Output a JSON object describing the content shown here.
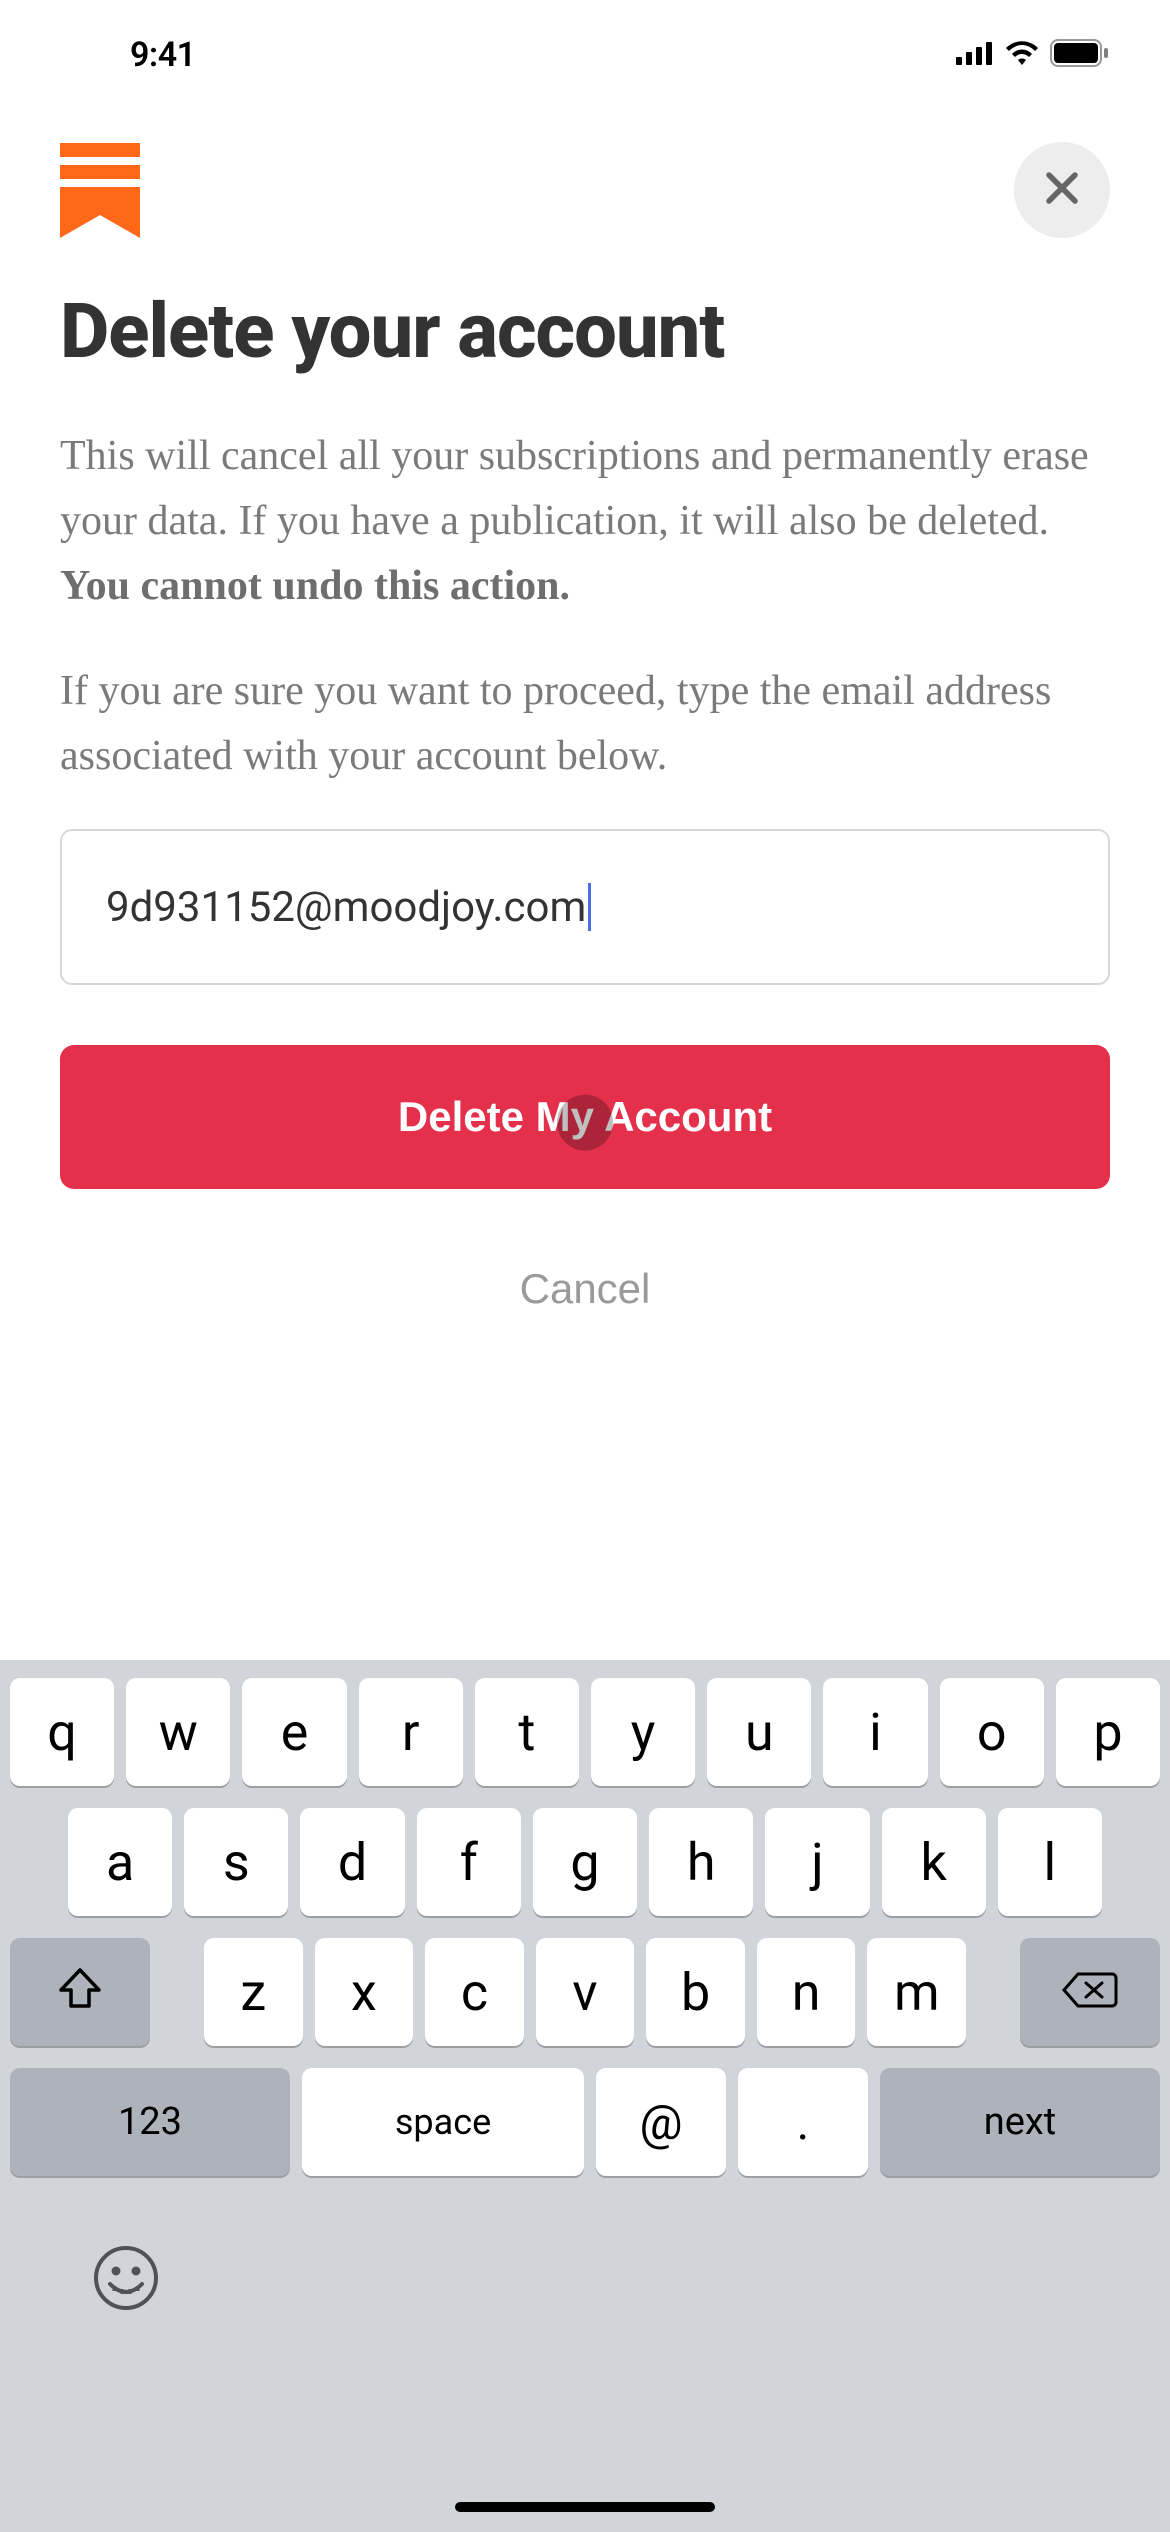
{
  "status": {
    "time": "9:41"
  },
  "nav": {
    "logo_color": "#ff6719"
  },
  "page": {
    "title": "Delete your account",
    "p1a": "This will cancel all your subscriptions and permanently erase your data. If you have a publication, it will also be deleted. ",
    "p1b": "You cannot undo this action.",
    "p2": "If you are sure you want to proceed, type the email address associated with your account below.",
    "email_value": "9d931152@moodjoy.com",
    "delete_label": "Delete My Account",
    "cancel_label": "Cancel"
  },
  "keyboard": {
    "row1": [
      "q",
      "w",
      "e",
      "r",
      "t",
      "y",
      "u",
      "i",
      "o",
      "p"
    ],
    "row2": [
      "a",
      "s",
      "d",
      "f",
      "g",
      "h",
      "j",
      "k",
      "l"
    ],
    "row3": [
      "z",
      "x",
      "c",
      "v",
      "b",
      "n",
      "m"
    ],
    "nums_label": "123",
    "space_label": "space",
    "at_label": "@",
    "dot_label": ".",
    "next_label": "next"
  }
}
